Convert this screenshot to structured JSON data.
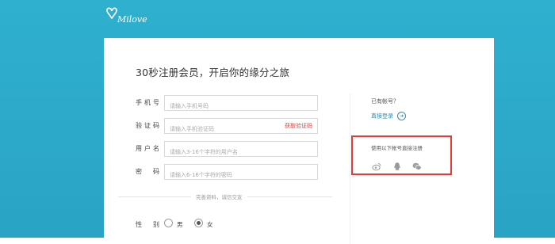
{
  "brand": {
    "logo_text": "Milove"
  },
  "form": {
    "title": "30秒注册会员，开启你的缘分之旅",
    "fields": [
      {
        "label": "手机号",
        "placeholder": "请输入手机号码"
      },
      {
        "label": "验证码",
        "placeholder": "请输入手机验证码",
        "action": "获取验证码"
      },
      {
        "label": "用户名",
        "placeholder": "请输入3-16个字符的用户名"
      },
      {
        "label": "密码",
        "placeholder": "请输入6-16个字符的密码"
      }
    ],
    "section_title": "完善资料，诚信交友",
    "gender": {
      "label": "性别",
      "options": [
        {
          "label": "男",
          "checked": false
        },
        {
          "label": "女",
          "checked": true
        }
      ]
    }
  },
  "sidebar": {
    "have_account": "已有帐号？",
    "login_link": "直接登录",
    "social_title": "使用以下帐号直接注册",
    "social": [
      {
        "name": "weibo-icon",
        "color": "#9a9a9a"
      },
      {
        "name": "qq-icon",
        "color": "#9a9a9a"
      },
      {
        "name": "wechat-icon",
        "color": "#9a9a9a"
      }
    ]
  },
  "colors": {
    "band": "#2fb0cf",
    "accent_link": "#2a8fb6",
    "highlight_box": "#e53935",
    "get_code": "#e23b3b"
  }
}
